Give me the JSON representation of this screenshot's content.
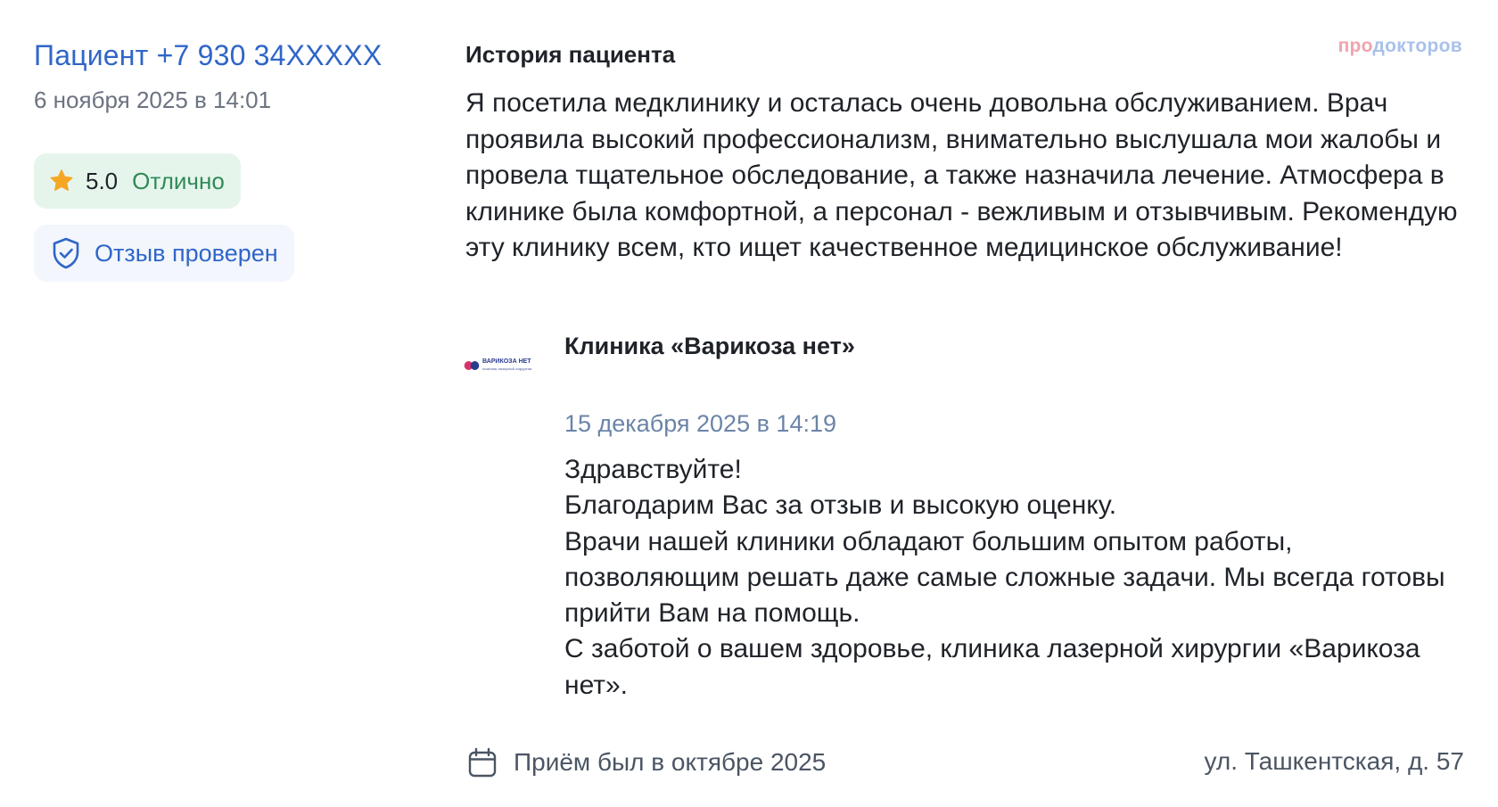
{
  "author": {
    "name": "Пациент +7 930 34XXXXX",
    "date": "6 ноября 2025 в 14:01"
  },
  "rating": {
    "value": "5.0",
    "label": "Отлично",
    "icon": "star-icon",
    "star_color": "#f5a623",
    "badge_bg": "#e6f5ec"
  },
  "verified": {
    "label": "Отзыв проверен",
    "icon": "shield-check-icon"
  },
  "review": {
    "section_title": "История пациента",
    "text": "Я посетила медклинику и осталась очень довольна обслуживанием. Врач проявила высокий профессионализм, внимательно выслушала мои жалобы и провела тщательное обследование, а также назначила лечение. Атмосфера в клинике была комфортной, а персонал - вежливым и отзывчивым. Рекомендую эту клинику всем, кто ищет качественное медицинское обслуживание!"
  },
  "brand": {
    "part1": "про",
    "part2": "докторов"
  },
  "reply": {
    "clinic_logo_text": "ВАРИКОЗА НЕТ",
    "clinic_logo_sub": "клиника лазерной хирургии",
    "clinic_name": "Клиника «Варикоза нет»",
    "date": "15 декабря 2025 в 14:19",
    "lines": [
      "Здравствуйте!",
      "Благодарим Вас за отзыв и высокую оценку.",
      "Врачи нашей клиники обладают большим опытом работы, позволяющим решать даже самые сложные задачи. Мы всегда готовы прийти Вам на помощь.",
      "С заботой о вашем здоровье, клиника лазерной хирургии «Варикоза нет»."
    ]
  },
  "footer": {
    "visit": "Приём был в октябре 2025",
    "visit_icon": "calendar-icon",
    "address": "ул. Ташкентская, д. 57"
  },
  "colors": {
    "accent": "#2f66c8",
    "positive": "#2f8a56",
    "muted": "#6b7280"
  }
}
